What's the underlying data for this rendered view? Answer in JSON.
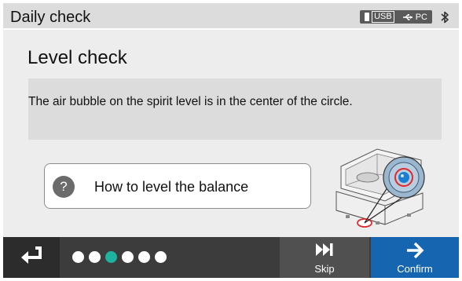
{
  "titlebar": {
    "title": "Daily check",
    "usb_label": "USB",
    "pc_label": "PC"
  },
  "main": {
    "heading": "Level check",
    "instruction": "The air bubble on the spirit level is in the center of the circle.",
    "help_button_label": "How to level the balance",
    "help_icon_glyph": "?"
  },
  "footer": {
    "skip_label": "Skip",
    "confirm_label": "Confirm",
    "progress": {
      "total_steps": 6,
      "current_step": 3
    }
  },
  "colors": {
    "accent": "#1fb2a0",
    "confirm": "#1565b0",
    "footer": "#3c3c3c",
    "highlight_red": "#e0282d",
    "bubble_blue": "#1a7fd0"
  }
}
